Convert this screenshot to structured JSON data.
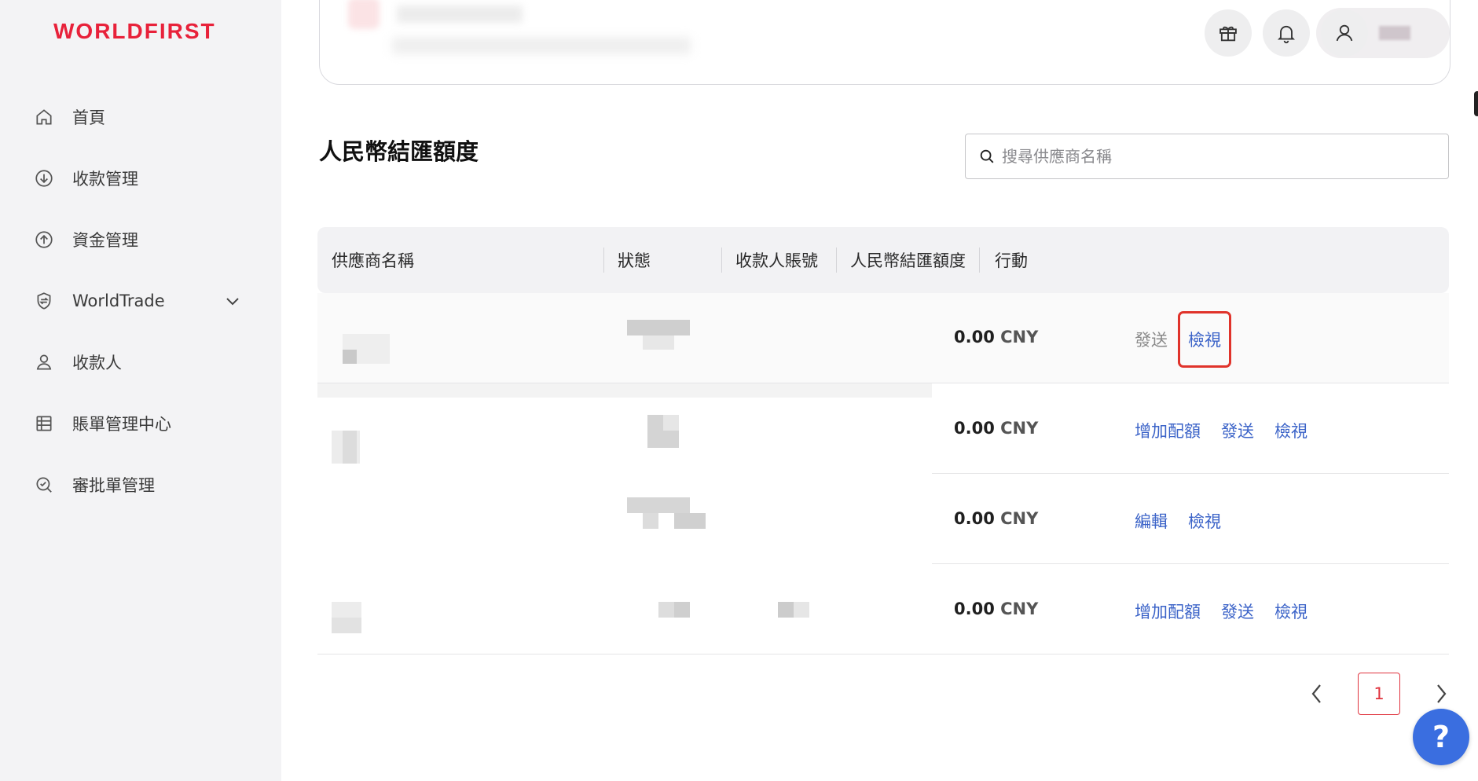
{
  "brand": {
    "logo": "WORLDFIRST",
    "color": "#e8213a"
  },
  "sidebar": {
    "items": [
      {
        "label": "首頁",
        "icon": "home-icon"
      },
      {
        "label": "收款管理",
        "icon": "download-circle-icon"
      },
      {
        "label": "資金管理",
        "icon": "upload-circle-icon"
      },
      {
        "label": "WorldTrade",
        "icon": "shield-exchange-icon",
        "expandable": true
      },
      {
        "label": "收款人",
        "icon": "person-icon"
      },
      {
        "label": "賬單管理中心",
        "icon": "list-icon"
      },
      {
        "label": "審批單管理",
        "icon": "search-check-icon"
      }
    ]
  },
  "header": {
    "icons": [
      "gift-icon",
      "bell-icon",
      "user-icon"
    ]
  },
  "page": {
    "title": "人民幣結匯額度",
    "search": {
      "placeholder": "搜尋供應商名稱",
      "value": ""
    }
  },
  "table": {
    "columns": [
      "供應商名稱",
      "狀態",
      "收款人賬號",
      "人民幣結匯額度",
      "行動"
    ],
    "rows": [
      {
        "amount": "0.00",
        "currency": "CNY",
        "actions": [
          "發送",
          "檢視"
        ]
      },
      {
        "amount": "0.00",
        "currency": "CNY",
        "actions": [
          "增加配額",
          "發送",
          "檢視"
        ]
      },
      {
        "amount": "0.00",
        "currency": "CNY",
        "actions": [
          "編輯",
          "檢視"
        ]
      },
      {
        "amount": "0.00",
        "currency": "CNY",
        "actions": [
          "增加配額",
          "發送",
          "檢視"
        ]
      }
    ]
  },
  "pagination": {
    "current": "1"
  },
  "help": {
    "label": "?"
  },
  "colors": {
    "link": "#3b63c8",
    "accent": "#e0333e",
    "help": "#3a6ee0"
  }
}
